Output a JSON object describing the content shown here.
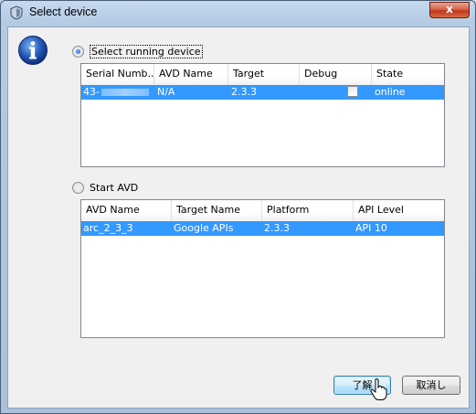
{
  "window": {
    "title": "Select device",
    "close_glyph": "x"
  },
  "running_section": {
    "radio_label": "Select running device",
    "selected": true,
    "columns": [
      "Serial Numb...",
      "AVD Name",
      "Target",
      "Debug",
      "State"
    ],
    "rows": [
      {
        "serial": "43-",
        "avd_name": "N/A",
        "target": "2.3.3",
        "debug": false,
        "state": "online"
      }
    ]
  },
  "avd_section": {
    "radio_label": "Start AVD",
    "selected": false,
    "columns": [
      "AVD Name",
      "Target Name",
      "Platform",
      "API Level"
    ],
    "rows": [
      {
        "avd_name": "arc_2_3_3",
        "target_name": "Google APIs",
        "platform": "2.3.3",
        "api_level": "API 10"
      }
    ]
  },
  "buttons": {
    "ok": "了解",
    "cancel": "取消し"
  },
  "icons": {
    "window_icon": "shield-window-icon",
    "info_icon": "info-icon",
    "cursor": "mouse-pointer-icon"
  },
  "colors": {
    "selection": "#3399ff",
    "title_bar": "#b4cbe4",
    "close_button": "#c2371c"
  }
}
